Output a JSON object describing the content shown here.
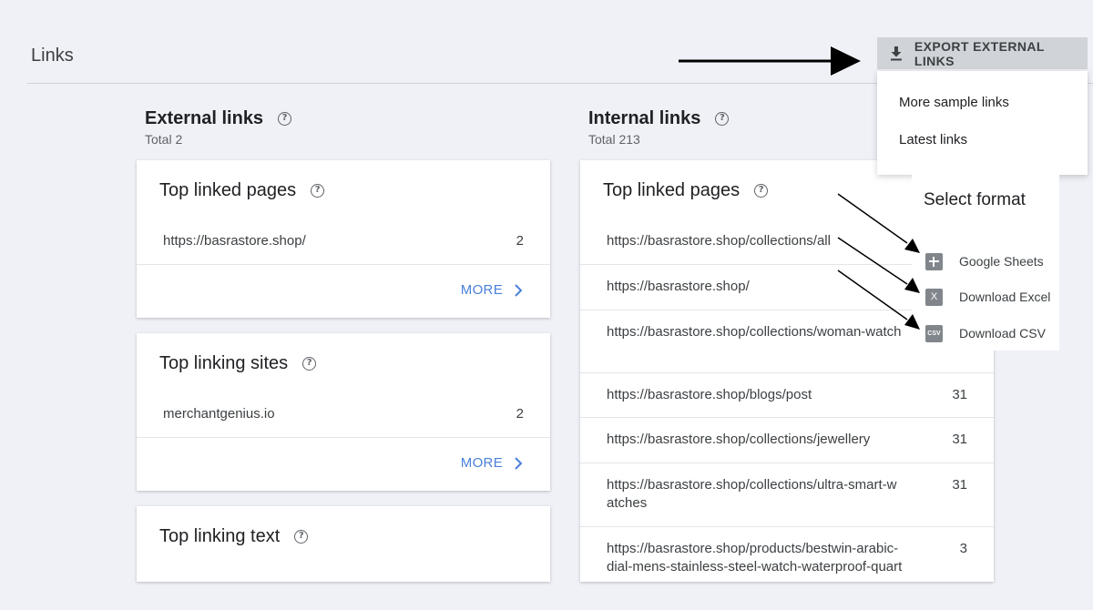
{
  "page": {
    "title": "Links"
  },
  "export": {
    "button_label": "EXPORT EXTERNAL LINKS",
    "menu_items": [
      "More sample links",
      "Latest links"
    ]
  },
  "format_panel": {
    "title": "Select format",
    "options": [
      {
        "label": "Google Sheets",
        "icon": "sheets-icon"
      },
      {
        "label": "Download Excel",
        "icon": "excel-icon",
        "glyph": "X"
      },
      {
        "label": "Download CSV",
        "icon": "csv-icon",
        "glyph": "CSV"
      }
    ]
  },
  "external": {
    "title": "External links",
    "total": "Total 2",
    "cards": [
      {
        "title": "Top linked pages",
        "rows": [
          {
            "url": "https://basrastore.shop/",
            "count": "2"
          }
        ],
        "more_label": "MORE"
      },
      {
        "title": "Top linking sites",
        "rows": [
          {
            "url": "merchantgenius.io",
            "count": "2"
          }
        ],
        "more_label": "MORE"
      },
      {
        "title": "Top linking text"
      }
    ]
  },
  "internal": {
    "title": "Internal links",
    "total": "Total 213",
    "card": {
      "title": "Top linked pages",
      "rows": [
        {
          "url": "https://basrastore.shop/collections/all",
          "count": ""
        },
        {
          "url": "https://basrastore.shop/",
          "count": ""
        },
        {
          "url": "https://basrastore.shop/collections/woman-watch",
          "count": ""
        },
        {
          "url": "https://basrastore.shop/blogs/post",
          "count": "31"
        },
        {
          "url": "https://basrastore.shop/collections/jewellery",
          "count": "31"
        },
        {
          "url": "https://basrastore.shop/collections/ultra-smart-watches",
          "count": "31"
        },
        {
          "url": "https://basrastore.shop/products/bestwin-arabic-dial-mens-stainless-steel-watch-waterproof-quartz",
          "count": "3"
        }
      ]
    }
  },
  "colors": {
    "accent": "#4a80d9",
    "background": "#eff1f6",
    "button": "#d0d3d8"
  }
}
